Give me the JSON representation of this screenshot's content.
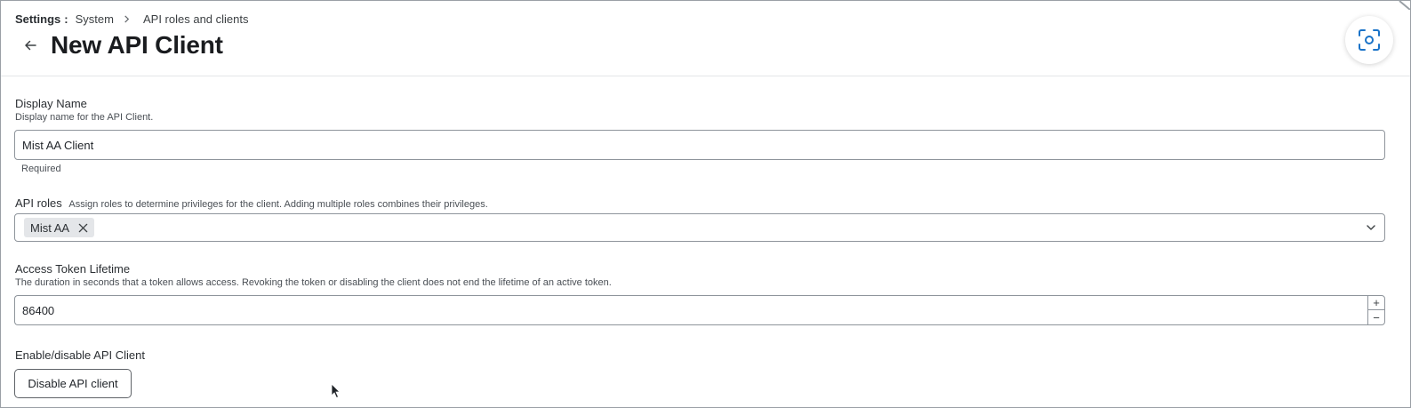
{
  "breadcrumb": {
    "root": "Settings",
    "separator": ":",
    "items": [
      "System",
      "API roles and clients"
    ]
  },
  "page": {
    "title": "New API Client"
  },
  "form": {
    "display_name": {
      "label": "Display Name",
      "description": "Display name for the API Client.",
      "value": "Mist AA Client",
      "helper": "Required"
    },
    "api_roles": {
      "label": "API roles",
      "description": "Assign roles to determine privileges for the client. Adding multiple roles combines their privileges.",
      "selected": [
        "Mist AA"
      ]
    },
    "token_lifetime": {
      "label": "Access Token Lifetime",
      "description": "The duration in seconds that a token allows access. Revoking the token or disabling the client does not end the lifetime of an active token.",
      "value": "86400",
      "increment": "+",
      "decrement": "−"
    },
    "enable_disable": {
      "label": "Enable/disable API Client",
      "button_label": "Disable API client"
    }
  },
  "icons": {
    "back": "arrow-left-icon",
    "breadcrumb_separator": "chevron-right-icon",
    "scan": "screen-capture-icon",
    "chip_remove": "close-icon",
    "dropdown": "chevron-down-icon",
    "cursor": "mouse-pointer-icon"
  },
  "colors": {
    "border": "#8e949b",
    "chip_bg": "#e4e6e9",
    "text": "#1f2328"
  }
}
